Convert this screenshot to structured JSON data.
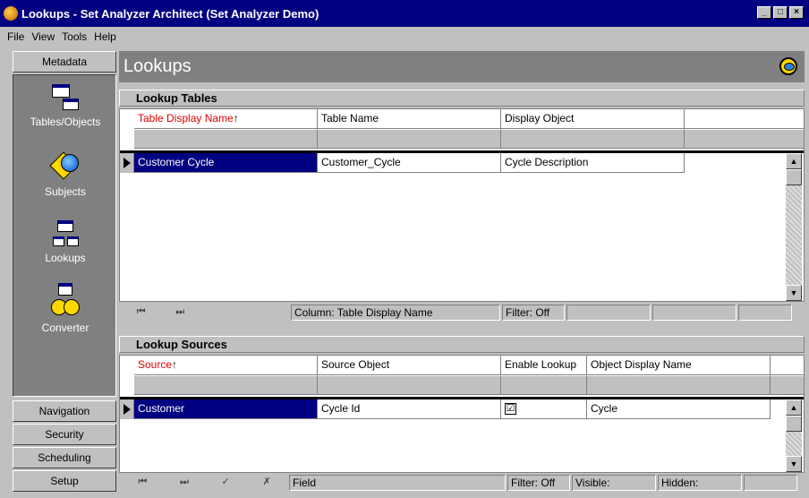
{
  "window": {
    "title": "Lookups - Set Analyzer Architect (Set Analyzer Demo)",
    "buttons": [
      "_",
      "□",
      "×"
    ]
  },
  "menu": [
    "File",
    "View",
    "Tools",
    "Help"
  ],
  "sidebar": {
    "top_button": "Metadata",
    "items": [
      {
        "label": "Tables/Objects",
        "icon": "table-icon"
      },
      {
        "label": "Subjects",
        "icon": "globe-icon"
      },
      {
        "label": "Lookups",
        "icon": "lookup-icon"
      },
      {
        "label": "Converter",
        "icon": "converter-icon"
      }
    ],
    "bottom_buttons": [
      "Navigation",
      "Security",
      "Scheduling",
      "Setup"
    ]
  },
  "page": {
    "title": "Lookups",
    "icon": "database-icon"
  },
  "lookup_tables": {
    "section_title": "Lookup Tables",
    "columns": [
      "Table Display Name",
      "Table Name",
      "Display Object"
    ],
    "sort_arrow": "↑",
    "rows": [
      [
        "Customer Cycle",
        "Customer_Cycle",
        "Cycle Description"
      ]
    ],
    "status": {
      "column": "Column: Table Display Name",
      "filter": "Filter: Off"
    },
    "nav": [
      "⏮",
      "⏭"
    ]
  },
  "lookup_sources": {
    "section_title": "Lookup Sources",
    "columns": [
      "Source",
      "Source Object",
      "Enable Lookup",
      "Object Display Name"
    ],
    "sort_arrow": "↑",
    "rows": [
      [
        "Customer",
        "Cycle Id",
        "☑",
        "Cycle"
      ]
    ],
    "status": {
      "field": "Field",
      "filter": "Filter: Off",
      "visible": "Visible:",
      "hidden": "Hidden:"
    },
    "nav": [
      "⏮",
      "⏭",
      "✓",
      "✗"
    ]
  }
}
